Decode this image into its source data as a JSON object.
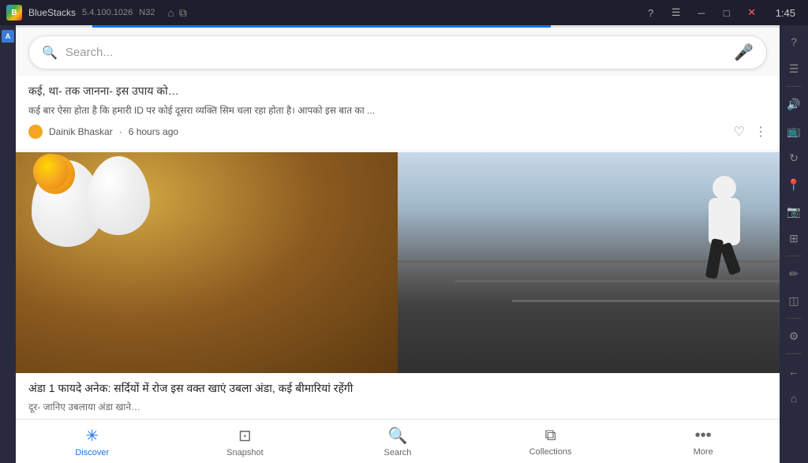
{
  "titleBar": {
    "appName": "BlueStacks",
    "version": "5.4.100.1026",
    "nTag": "N32",
    "time": "1:45"
  },
  "progressBar": {
    "fillPercent": 60
  },
  "searchBar": {
    "placeholder": "Search..."
  },
  "articleTop": {
    "titlePartial": "कई, था- तक जानना- इस उपाय को…",
    "excerpt": "कई बार ऐसा होता है कि हमारी ID पर कोई दूसरा व्यक्ति सिम चला रहा होता है। आपको इस बात का ...",
    "sourceName": "Dainik Bhaskar",
    "timeAgo": "6 hours ago"
  },
  "imageArticle": {
    "caption": "अंडा 1 फायदे अनेक: सर्दियों में रोज इस वक्त खाएं उबला अंडा, कई बीमारियां रहेंगी",
    "captionSub": "दूर- जानिए उबलाया अंडा खाने…"
  },
  "bottomNav": {
    "items": [
      {
        "id": "discover",
        "label": "Discover",
        "active": true
      },
      {
        "id": "snapshot",
        "label": "Snapshot",
        "active": false
      },
      {
        "id": "search",
        "label": "Search",
        "active": false
      },
      {
        "id": "collections",
        "label": "Collections",
        "active": false
      },
      {
        "id": "more",
        "label": "More",
        "active": false
      }
    ]
  },
  "rightSidebar": {
    "buttons": [
      "question",
      "menu",
      "volume",
      "screen",
      "rotate",
      "location",
      "camera",
      "crop",
      "draw",
      "layers",
      "settings",
      "back",
      "home"
    ]
  }
}
